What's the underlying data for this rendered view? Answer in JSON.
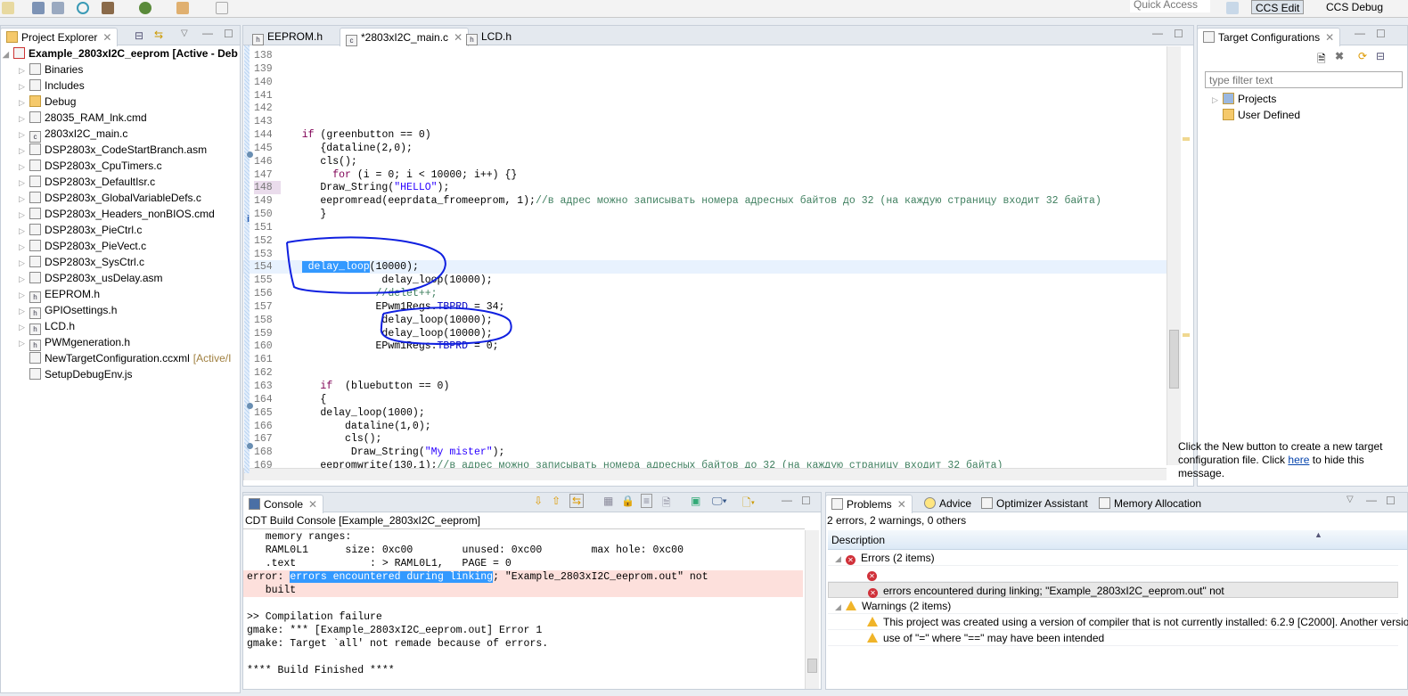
{
  "toolbar": {
    "quick_access": "Quick Access",
    "perspectives": [
      "CCS Edit",
      "CCS Debug"
    ]
  },
  "explorer": {
    "title": "Project Explorer",
    "project": "Example_2803xI2C_eeprom",
    "project_status": "[Active - Deb",
    "items": [
      {
        "label": "Binaries",
        "icon": "binaries-icon",
        "exp": true
      },
      {
        "label": "Includes",
        "icon": "includes-icon",
        "exp": true
      },
      {
        "label": "Debug",
        "icon": "folder-icon",
        "exp": true
      },
      {
        "label": "28035_RAM_lnk.cmd",
        "icon": "cmd-file-icon",
        "exp": true
      },
      {
        "label": "2803xI2C_main.c",
        "icon": "c-file-icon",
        "exp": true
      },
      {
        "label": "DSP2803x_CodeStartBranch.asm",
        "icon": "linked-file-icon",
        "exp": true
      },
      {
        "label": "DSP2803x_CpuTimers.c",
        "icon": "linked-file-icon",
        "exp": true
      },
      {
        "label": "DSP2803x_DefaultIsr.c",
        "icon": "linked-file-icon",
        "exp": true
      },
      {
        "label": "DSP2803x_GlobalVariableDefs.c",
        "icon": "linked-file-icon",
        "exp": true
      },
      {
        "label": "DSP2803x_Headers_nonBIOS.cmd",
        "icon": "cmd-file-icon",
        "exp": true
      },
      {
        "label": "DSP2803x_PieCtrl.c",
        "icon": "linked-file-icon",
        "exp": true
      },
      {
        "label": "DSP2803x_PieVect.c",
        "icon": "linked-file-icon",
        "exp": true
      },
      {
        "label": "DSP2803x_SysCtrl.c",
        "icon": "linked-file-icon",
        "exp": true
      },
      {
        "label": "DSP2803x_usDelay.asm",
        "icon": "linked-file-icon",
        "exp": true
      },
      {
        "label": "EEPROM.h",
        "icon": "h-file-icon",
        "exp": true
      },
      {
        "label": "GPIOsettings.h",
        "icon": "h-file-icon",
        "exp": true
      },
      {
        "label": "LCD.h",
        "icon": "h-file-warning-icon",
        "exp": true
      },
      {
        "label": "PWMgeneration.h",
        "icon": "h-file-icon",
        "exp": true
      },
      {
        "label": "NewTargetConfiguration.ccxml",
        "icon": "target-config-icon",
        "exp": false,
        "suffix": "[Active/I"
      },
      {
        "label": "SetupDebugEnv.js",
        "icon": "js-file-icon",
        "exp": false
      }
    ]
  },
  "editor": {
    "tabs": [
      {
        "label": "EEPROM.h",
        "icon": "h"
      },
      {
        "label": "*2803xI2C_main.c",
        "icon": "c"
      },
      {
        "label": "LCD.h",
        "icon": "h"
      }
    ],
    "lines": [
      {
        "n": "138",
        "s": []
      },
      {
        "n": "139",
        "s": []
      },
      {
        "n": "140",
        "s": []
      },
      {
        "n": "141",
        "s": []
      },
      {
        "n": "142",
        "s": []
      },
      {
        "n": "143",
        "s": []
      },
      {
        "n": "144",
        "bp": true,
        "s": [
          {
            "t": "   "
          },
          {
            "t": "if",
            "c": "kw"
          },
          {
            "t": " (greenbutton == 0)"
          }
        ]
      },
      {
        "n": "145",
        "s": [
          {
            "t": "      {dataline(2,0);"
          }
        ]
      },
      {
        "n": "146",
        "s": [
          {
            "t": "      cls();"
          }
        ]
      },
      {
        "n": "147",
        "s": [
          {
            "t": "        "
          },
          {
            "t": "for",
            "c": "kw"
          },
          {
            "t": " (i = 0; i < 10000; i++) {}"
          }
        ]
      },
      {
        "n": "148",
        "s": [
          {
            "t": "      Draw_String("
          },
          {
            "t": "\"HELLO\"",
            "c": "str"
          },
          {
            "t": ");"
          }
        ]
      },
      {
        "n": "149",
        "info": true,
        "s": [
          {
            "t": "      eepromread(eeprdata_fromeeprom, 1);"
          },
          {
            "t": "//в адрес можно записывать номера адресных байтов до 32 (на каждую страницу входит 32 байта)",
            "c": "cmt"
          }
        ]
      },
      {
        "n": "150",
        "s": [
          {
            "t": "      }"
          }
        ]
      },
      {
        "n": "151",
        "s": []
      },
      {
        "n": "152",
        "s": []
      },
      {
        "n": "153",
        "s": []
      },
      {
        "n": "154",
        "cur": true,
        "s": [
          {
            "t": "   "
          },
          {
            "t": " delay_loop",
            "c": "sel"
          },
          {
            "t": "(10000);"
          }
        ]
      },
      {
        "n": "155",
        "s": [
          {
            "t": "                delay_loop(10000);"
          }
        ]
      },
      {
        "n": "156",
        "s": [
          {
            "t": "               "
          },
          {
            "t": "//delet++;",
            "c": "cmt"
          }
        ]
      },
      {
        "n": "157",
        "s": [
          {
            "t": "               EPwm1Regs."
          },
          {
            "t": "TBPRD",
            "c": "fld"
          },
          {
            "t": " = 34;"
          }
        ]
      },
      {
        "n": "158",
        "s": [
          {
            "t": "                delay_loop(10000);"
          }
        ]
      },
      {
        "n": "159",
        "s": [
          {
            "t": "                delay_loop(10000);"
          }
        ]
      },
      {
        "n": "160",
        "s": [
          {
            "t": "               EPwm1Regs."
          },
          {
            "t": "TBPRD",
            "c": "fld"
          },
          {
            "t": " = 0;"
          }
        ]
      },
      {
        "n": "161",
        "s": []
      },
      {
        "n": "162",
        "s": []
      },
      {
        "n": "163",
        "bp": true,
        "s": [
          {
            "t": "      "
          },
          {
            "t": "if",
            "c": "kw"
          },
          {
            "t": "  (bluebutton == 0)"
          }
        ]
      },
      {
        "n": "164",
        "s": [
          {
            "t": "      {"
          }
        ]
      },
      {
        "n": "165",
        "s": [
          {
            "t": "      delay_loop(1000);"
          }
        ]
      },
      {
        "n": "166",
        "bp": true,
        "s": [
          {
            "t": "          dataline(1,0);"
          }
        ]
      },
      {
        "n": "167",
        "s": [
          {
            "t": "          cls();"
          }
        ]
      },
      {
        "n": "168",
        "s": [
          {
            "t": "           Draw_String("
          },
          {
            "t": "\"My mister\"",
            "c": "str"
          },
          {
            "t": ");"
          }
        ]
      },
      {
        "n": "169",
        "s": [
          {
            "t": "      eepromwrite(130,1);"
          },
          {
            "t": "//в адрес можно записывать номера адресных байтов до 32 (на каждую страницу входит 32 байта)",
            "c": "cmt"
          }
        ]
      }
    ]
  },
  "target": {
    "title": "Target Configurations",
    "filter_placeholder": "type filter text",
    "nodes": [
      "Projects",
      "User Defined"
    ],
    "msg_before": "Click the New button to create a new target configuration file. Click ",
    "msg_link": "here",
    "msg_after": " to hide this message."
  },
  "console": {
    "title": "Console",
    "subtitle": "CDT Build Console [Example_2803xI2C_eeprom]",
    "lines": [
      {
        "s": [
          {
            "t": "   memory ranges:"
          }
        ]
      },
      {
        "s": [
          {
            "t": "   RAML0L1      size: 0xc00        unused: 0xc00        max hole: 0xc00"
          }
        ]
      },
      {
        "s": [
          {
            "t": "   .text            : > RAML0L1,   PAGE = 0"
          }
        ]
      },
      {
        "err": true,
        "s": [
          {
            "t": "error: "
          },
          {
            "t": "errors encountered during linking",
            "c": "sel"
          },
          {
            "t": "; \"Example_2803xI2C_eeprom.out\" not"
          }
        ]
      },
      {
        "err": true,
        "s": [
          {
            "t": "   built"
          }
        ]
      },
      {
        "s": []
      },
      {
        "s": [
          {
            "t": ">> Compilation failure"
          }
        ]
      },
      {
        "s": [
          {
            "t": "gmake: *** [Example_2803xI2C_eeprom.out] Error 1"
          }
        ]
      },
      {
        "s": [
          {
            "t": "gmake: Target `all' not remade because of errors."
          }
        ]
      },
      {
        "s": []
      },
      {
        "s": [
          {
            "t": "**** Build Finished ****"
          }
        ]
      }
    ]
  },
  "problems": {
    "tabs": [
      "Problems",
      "Advice",
      "Optimizer Assistant",
      "Memory Allocation"
    ],
    "summary": "2 errors, 2 warnings, 0 others",
    "column": "Description",
    "errors_group": "Errors (2 items)",
    "errors": [
      "",
      "errors encountered during linking; \"Example_2803xI2C_eeprom.out\" not"
    ],
    "warnings_group": "Warnings (2 items)",
    "warnings": [
      "This project was created using a version of compiler that is not currently installed: 6.2.9 [C2000]. Another versio",
      "use of \"=\" where \"==\" may have been intended"
    ]
  }
}
